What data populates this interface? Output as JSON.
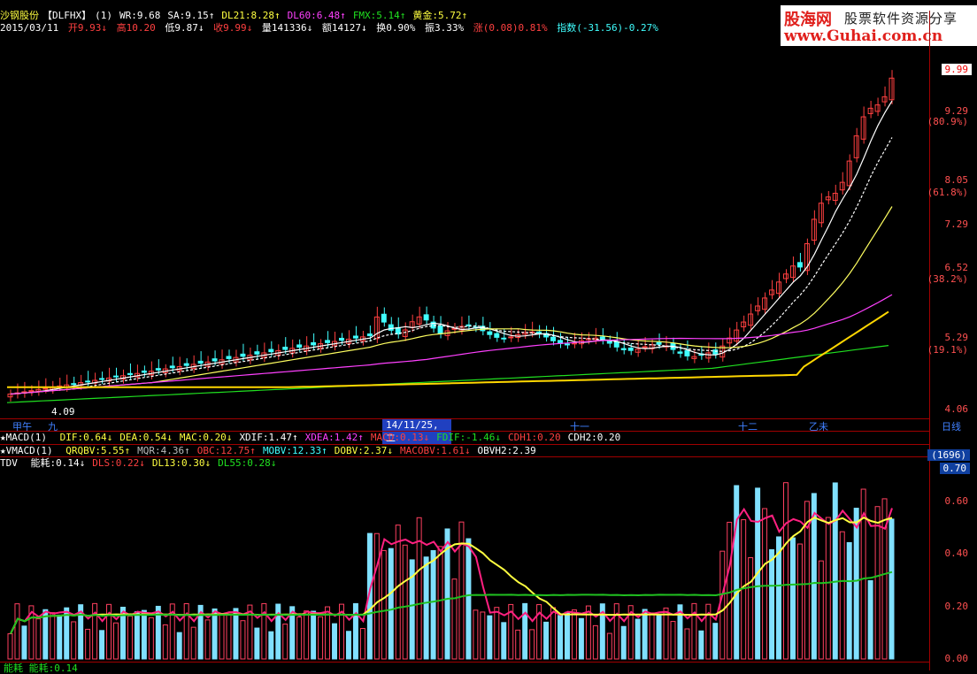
{
  "header": {
    "stock_name": "沙钢股份",
    "indicator": "【DLFHX】",
    "period": "(1)",
    "items": [
      {
        "label": "WR:9.68",
        "color": "#ffffff"
      },
      {
        "label": "SA:9.15↑",
        "color": "#ffffff"
      },
      {
        "label": "DL21:8.28↑",
        "color": "#ffff40"
      },
      {
        "label": "DL60:6.48↑",
        "color": "#ff40ff"
      },
      {
        "label": "FMX:5.14↑",
        "color": "#20e020"
      },
      {
        "label": "黄金:5.72↑",
        "color": "#ffff40"
      }
    ]
  },
  "quote": {
    "date": "2015/03/11",
    "open": "开9.93↓",
    "high": "高10.20",
    "low": "低9.87↓",
    "close": "收9.99↓",
    "volume": "量141336↓",
    "amount": "额14127↓",
    "turnover": "换0.90%",
    "amplitude": "振3.33%",
    "change": "涨(0.08)0.81%",
    "index": "指数(-31.56)-0.27%"
  },
  "price_axis": [
    {
      "label": "9.99",
      "boxed": true
    },
    {
      "label": "9.29"
    },
    {
      "label": "(80.9%)"
    },
    {
      "label": "8.05"
    },
    {
      "label": "(61.8%)"
    },
    {
      "label": "7.29"
    },
    {
      "label": "6.52"
    },
    {
      "label": "(38.2%)"
    },
    {
      "label": "5.29"
    },
    {
      "label": "(19.1%)"
    },
    {
      "label": "4.06"
    }
  ],
  "low_marker": "4.09",
  "time_axis": [
    {
      "label": "甲午"
    },
    {
      "label": "九"
    },
    {
      "label": "14/11/25,二",
      "highlight": true
    },
    {
      "label": "十一"
    },
    {
      "label": "十二"
    },
    {
      "label": "乙未"
    },
    {
      "label": "日线"
    }
  ],
  "macd_row": {
    "title": "★MACD(1)",
    "items": [
      {
        "label": "DIF:0.64↓",
        "color": "#ffff40"
      },
      {
        "label": "DEA:0.54↓",
        "color": "#ffff40"
      },
      {
        "label": "MAC:0.20↓",
        "color": "#ffff40"
      },
      {
        "label": "XDIF:1.47↑",
        "color": "#ffffff"
      },
      {
        "label": "XDEA:1.42↑",
        "color": "#ff40ff"
      },
      {
        "label": "MACD:0.13↓",
        "color": "#ff4040"
      },
      {
        "label": "FDIF:-1.46↓",
        "color": "#20e020"
      },
      {
        "label": "CDH1:0.20",
        "color": "#ff4040"
      },
      {
        "label": "CDH2:0.20",
        "color": "#ffffff"
      }
    ]
  },
  "vmacd_row": {
    "title": "★VMACD(1)",
    "items": [
      {
        "label": "QRQBV:5.55↑",
        "color": "#ffff40"
      },
      {
        "label": "MQR:4.36↑",
        "color": "#bbbbbb"
      },
      {
        "label": "OBC:12.75↑",
        "color": "#ff4040"
      },
      {
        "label": "MOBV:12.33↑",
        "color": "#40ffff"
      },
      {
        "label": "DOBV:2.37↓",
        "color": "#ffff40"
      },
      {
        "label": "MACOBV:1.61↓",
        "color": "#ff4040"
      },
      {
        "label": "OBVH2:2.39",
        "color": "#ffffff"
      }
    ]
  },
  "tdv_row": {
    "title": "TDV",
    "items": [
      {
        "label": "能耗:0.14↓",
        "color": "#ffffff"
      },
      {
        "label": "DLS:0.22↓",
        "color": "#ff4040"
      },
      {
        "label": "DL13:0.30↓",
        "color": "#ffff40"
      },
      {
        "label": "DL55:0.28↓",
        "color": "#20e020"
      }
    ]
  },
  "volume_axis": [
    {
      "label": "(1696)",
      "boxed": true
    },
    {
      "label": "0.70",
      "boxed": true
    },
    {
      "label": "0.60"
    },
    {
      "label": "0.40"
    },
    {
      "label": "0.20"
    },
    {
      "label": "0.00"
    }
  ],
  "bottom_partial": "能耗 能耗:0.14",
  "watermark": {
    "brand": "股海网",
    "slogan": "股票软件资源分享",
    "url": "www.Guhai.com.cn"
  },
  "colors": {
    "up": "#ff4040",
    "down": "#40ffff",
    "grid": "#a00000"
  }
}
